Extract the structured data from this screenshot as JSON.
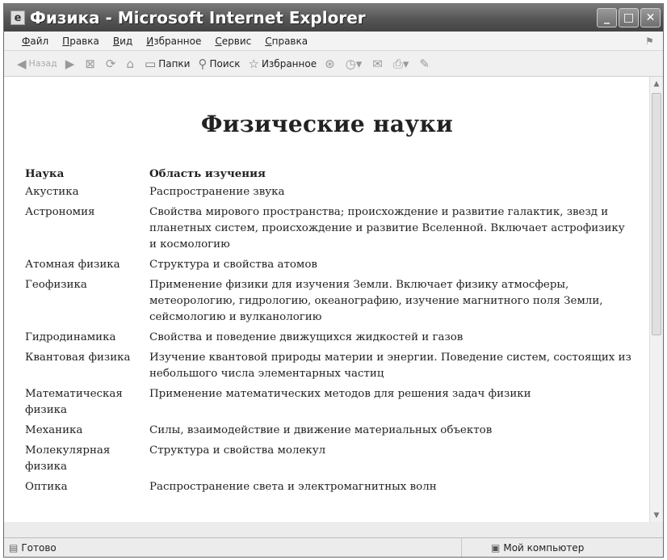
{
  "window": {
    "title": "Физика - Microsoft Internet Explorer"
  },
  "menu": [
    "Файл",
    "Правка",
    "Вид",
    "Избранное",
    "Сервис",
    "Справка"
  ],
  "toolbar": {
    "back_label": "Назад",
    "folders_label": "Папки",
    "search_label": "Поиск",
    "favorites_label": "Избранное"
  },
  "page": {
    "heading": "Физические науки",
    "table": {
      "headers": [
        "Наука",
        "Область изучения"
      ],
      "rows": [
        [
          "Акустика",
          "Распространение звука"
        ],
        [
          "Астрономия",
          "Свойства мирового пространства; происхождение и развитие галактик, звезд и планетных систем, происхождение и развитие Вселенной. Включает астрофизику и космологию"
        ],
        [
          "Атомная физика",
          "Структура и свойства атомов"
        ],
        [
          "Геофизика",
          "Применение физики для изучения Земли. Включает физику атмосферы, метеорологию, гидрологию, океанографию, изучение магнитного поля Земли, сейсмологию и вулканологию"
        ],
        [
          "Гидродинамика",
          "Свойства и поведение движущихся жидкостей и газов"
        ],
        [
          "Квантовая физика",
          "Изучение квантовой природы материи и энергии. Поведение систем, состоящих из небольшого числа элементарных частиц"
        ],
        [
          "Математическая физика",
          "Применение математических методов для решения задач физики"
        ],
        [
          "Механика",
          "Силы, взаимодействие и движение материальных объектов"
        ],
        [
          "Молекулярная физика",
          "Структура и свойства молекул"
        ],
        [
          "Оптика",
          "Распространение света и электромагнитных волн"
        ]
      ]
    }
  },
  "status": {
    "text": "Готово",
    "zone": "Мой компьютер"
  }
}
